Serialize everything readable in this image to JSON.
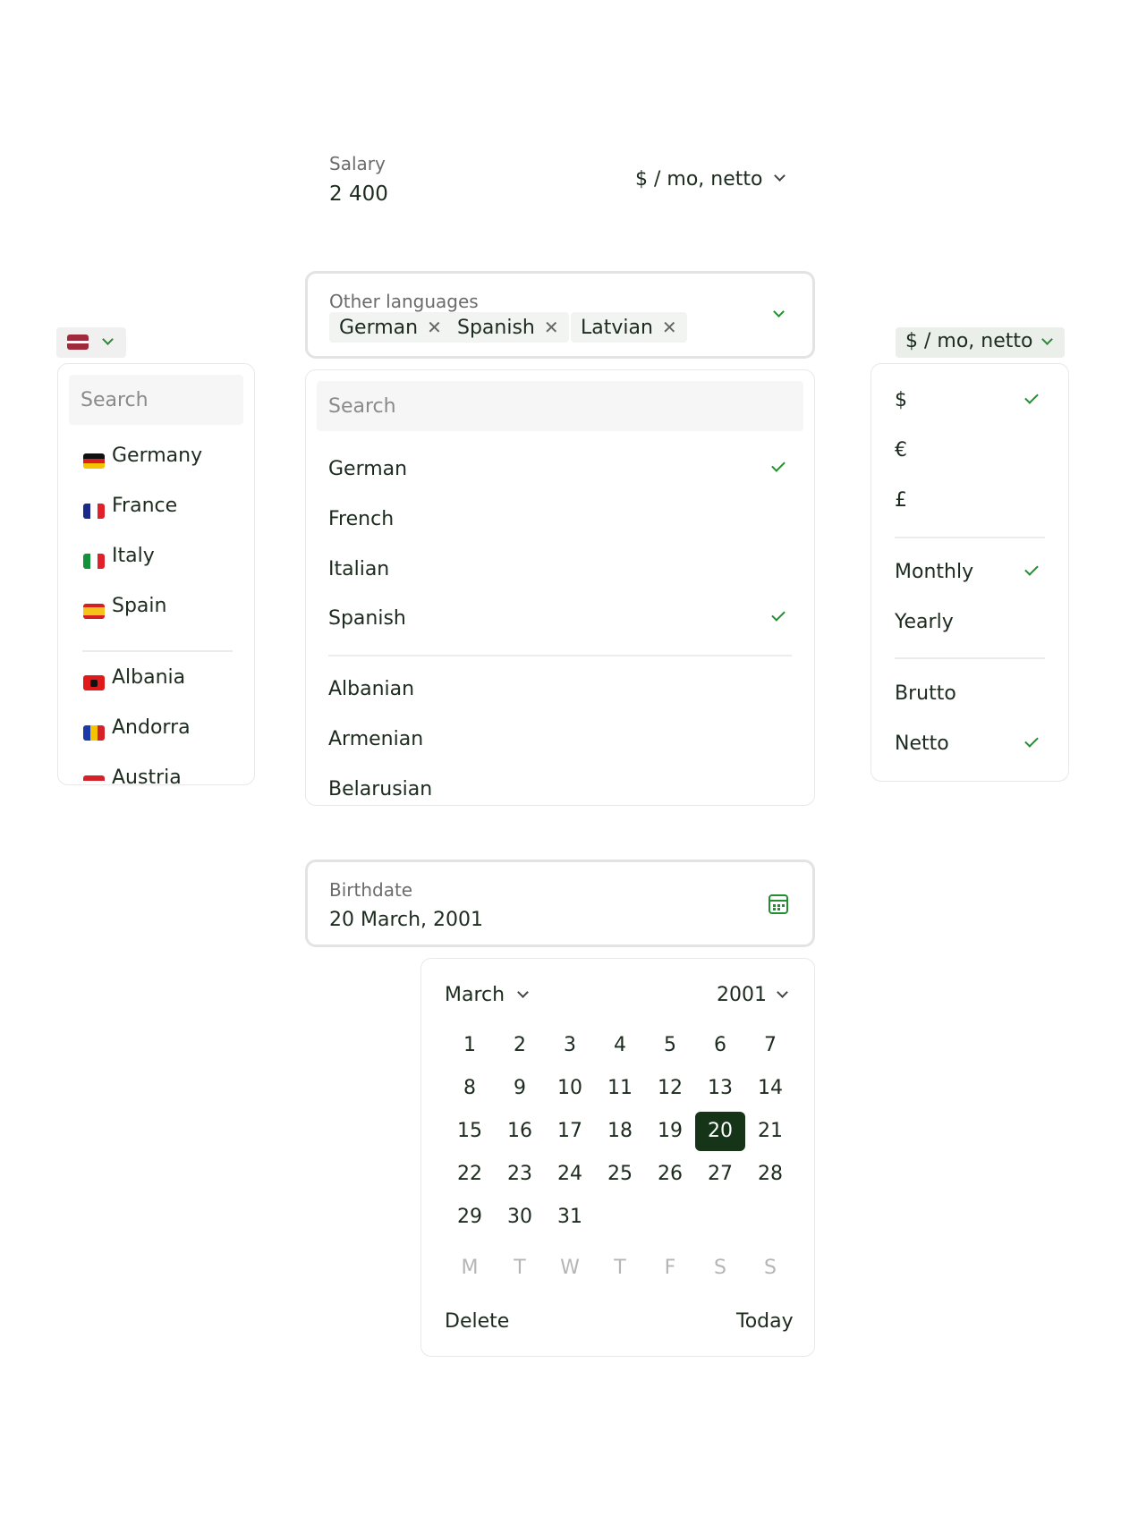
{
  "salary": {
    "label": "Salary",
    "value": "2 400",
    "unit_selector": "$ / mo, netto"
  },
  "languages": {
    "label": "Other languages",
    "chips": [
      "German",
      "Spanish",
      "Latvian"
    ],
    "chip_remove": "✕",
    "dropdown": {
      "search_placeholder": "Search",
      "items": [
        {
          "label": "German",
          "checked": true
        },
        {
          "label": "French",
          "checked": false
        },
        {
          "label": "Italian",
          "checked": false
        },
        {
          "label": "Spanish",
          "checked": true
        },
        {
          "label": "Albanian",
          "checked": false
        },
        {
          "label": "Armenian",
          "checked": false
        },
        {
          "label": "Belarusian",
          "checked": false
        }
      ]
    }
  },
  "country_picker": {
    "selected_flag": "latvia-flag",
    "search_placeholder": "Search",
    "items": [
      {
        "label": "Germany",
        "flag": "germany-flag"
      },
      {
        "label": "France",
        "flag": "france-flag"
      },
      {
        "label": "Italy",
        "flag": "italy-flag"
      },
      {
        "label": "Spain",
        "flag": "spain-flag"
      },
      {
        "label": "Albania",
        "flag": "albania-flag"
      },
      {
        "label": "Andorra",
        "flag": "andorra-flag"
      },
      {
        "label": "Austria",
        "flag": "austria-flag"
      }
    ]
  },
  "currency_picker": {
    "button_label": "$ / mo, netto",
    "currencies": [
      {
        "label": "$",
        "checked": true
      },
      {
        "label": "€",
        "checked": false
      },
      {
        "label": "£",
        "checked": false
      }
    ],
    "periods": [
      {
        "label": "Monthly",
        "checked": true
      },
      {
        "label": "Yearly",
        "checked": false
      }
    ],
    "tax": [
      {
        "label": "Brutto",
        "checked": false
      },
      {
        "label": "Netto",
        "checked": true
      }
    ]
  },
  "birthdate": {
    "label": "Birthdate",
    "value": "20 March, 2001",
    "icon": "calendar-icon"
  },
  "calendar": {
    "month": "March",
    "year": "2001",
    "weeks": [
      [
        "1",
        "2",
        "3",
        "4",
        "5",
        "6",
        "7"
      ],
      [
        "8",
        "9",
        "10",
        "11",
        "12",
        "13",
        "14"
      ],
      [
        "15",
        "16",
        "17",
        "18",
        "19",
        "20",
        "21"
      ],
      [
        "22",
        "23",
        "24",
        "25",
        "26",
        "27",
        "28"
      ],
      [
        "29",
        "30",
        "31"
      ]
    ],
    "selected_day": "20",
    "weekdays": [
      "M",
      "T",
      "W",
      "T",
      "F",
      "S",
      "S"
    ],
    "delete_label": "Delete",
    "today_label": "Today"
  },
  "colors": {
    "accent_green": "#22902e",
    "selected_day_bg": "#163518",
    "chip_bg": "#f1f4f1"
  }
}
